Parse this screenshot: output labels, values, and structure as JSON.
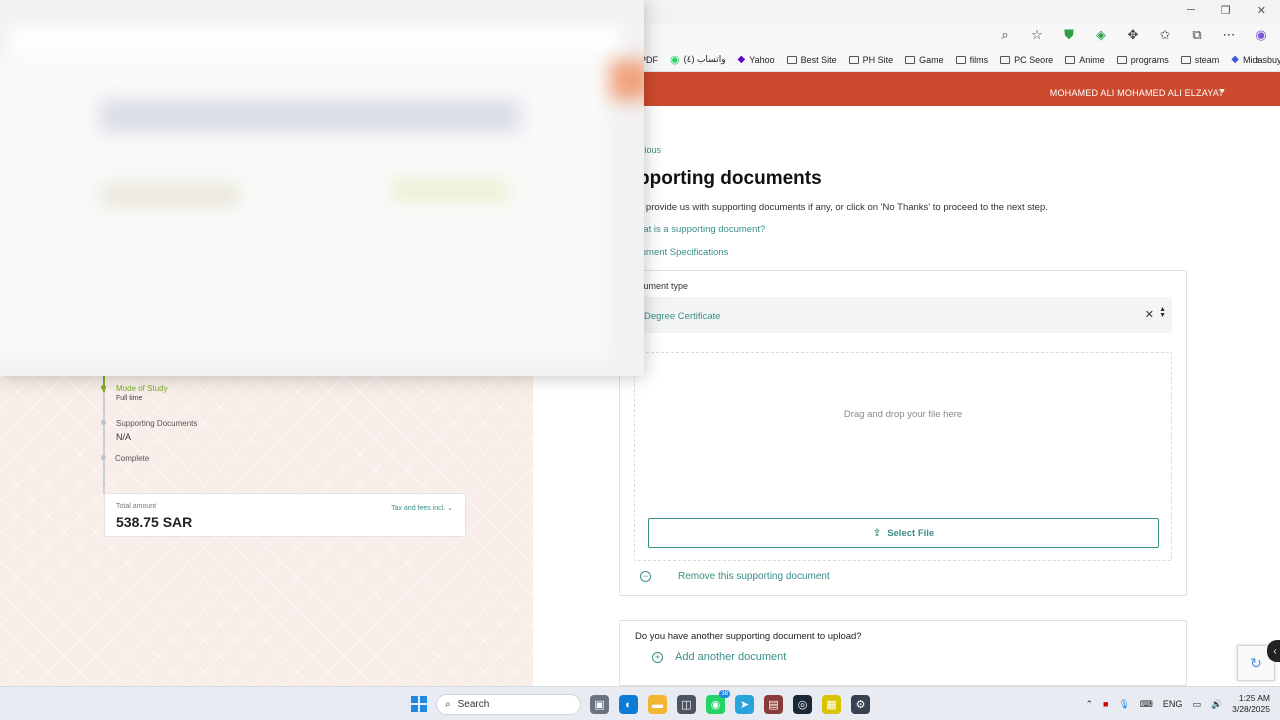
{
  "browser": {
    "window_controls": [
      "─",
      "❐",
      "✕"
    ],
    "toolbar_icons": [
      "zoom-icon",
      "star-icon",
      "shield-icon",
      "extension-icon",
      "puzzle-icon",
      "favorites-icon",
      "collections-icon",
      "more-icon",
      "copilot-icon"
    ],
    "bookmarks": [
      {
        "label": "PDF",
        "icon": "pdf-icon"
      },
      {
        "label": "واتساب (٤)",
        "icon": "whatsapp-icon"
      },
      {
        "label": "Yahoo",
        "icon": "yahoo-icon"
      },
      {
        "label": "Best Site",
        "icon": "folder-icon"
      },
      {
        "label": "PH Site",
        "icon": "folder-icon"
      },
      {
        "label": "Game",
        "icon": "folder-icon"
      },
      {
        "label": "films",
        "icon": "folder-icon"
      },
      {
        "label": "PC Seore",
        "icon": "folder-icon"
      },
      {
        "label": "Anime",
        "icon": "folder-icon"
      },
      {
        "label": "programs",
        "icon": "folder-icon"
      },
      {
        "label": "steam",
        "icon": "folder-icon"
      },
      {
        "label": "Midasbuy",
        "icon": "midasbuy-icon"
      }
    ]
  },
  "header": {
    "user_name": "MOHAMED ALI MOHAMED ALI ELZAYAT",
    "brand_color": "#cc4a2d"
  },
  "steps": [
    {
      "title": "Mode of Study",
      "value": "Full time",
      "active": true
    },
    {
      "title": "Supporting Documents",
      "value": "N/A",
      "active": false
    },
    {
      "title": "Complete",
      "value": "",
      "active": false
    }
  ],
  "total": {
    "label": "Total amount",
    "value": "538.75 SAR",
    "tax_link": "Tax and fees incl."
  },
  "main": {
    "previous_link": "vious",
    "title": "pporting documents",
    "intro": "e provide us with supporting documents if any, or click on 'No Thanks' to proceed to the next step.",
    "what_is_link": "hat is a supporting document?",
    "spec_link": "cument Specifications",
    "document_type_label": "cument type",
    "document_type_value": "Degree Certificate",
    "drop_text": "Drag and drop your file here",
    "select_file_label": "Select File",
    "remove_label": "Remove this supporting document",
    "another_question": "Do you have another supporting document to upload?",
    "add_another_label": "Add another document",
    "accent_color": "#3a8f86"
  },
  "taskbar": {
    "search_placeholder": "Search",
    "whatsapp_badge": "38",
    "language": "ENG",
    "time": "1:25 AM",
    "date": "3/28/2025"
  }
}
